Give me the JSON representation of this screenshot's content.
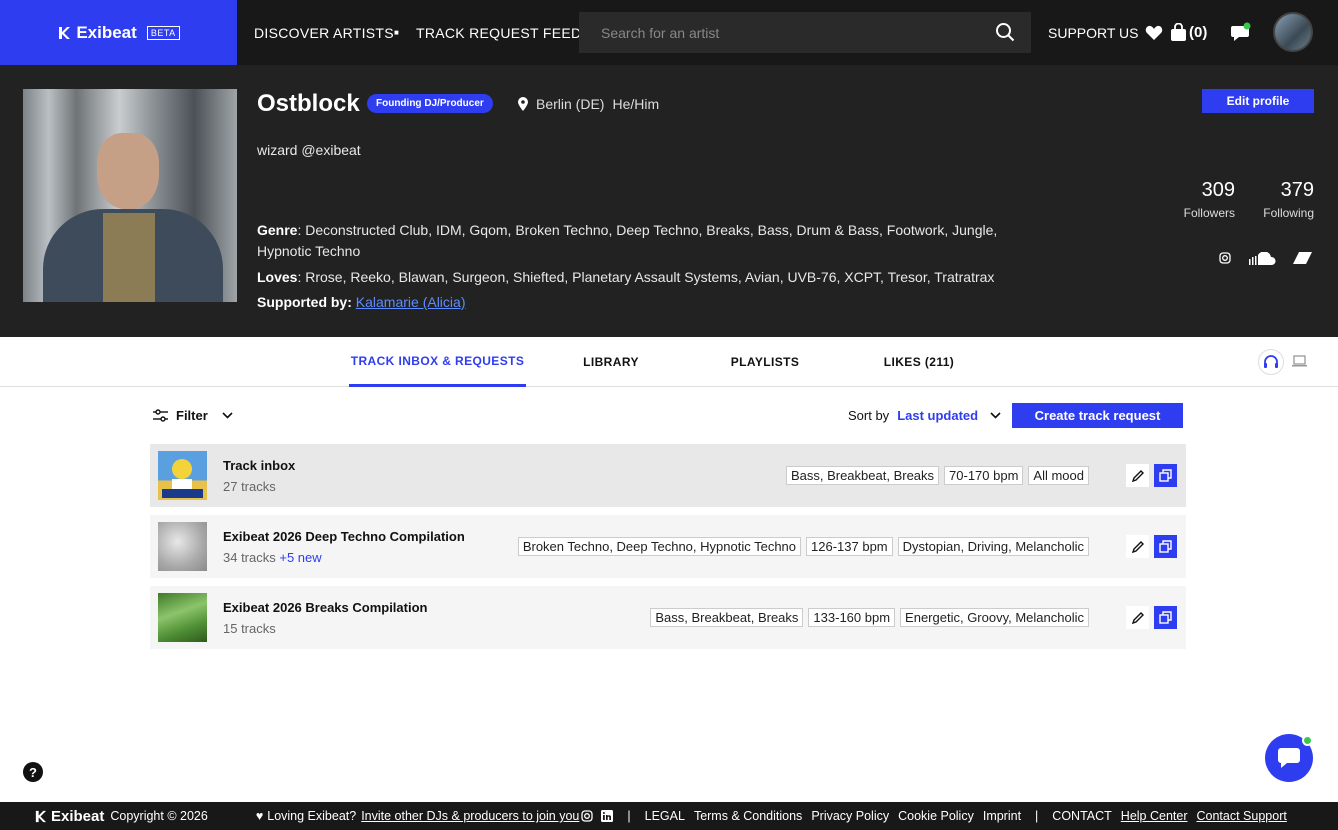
{
  "header": {
    "brand": "Exibeat",
    "beta": "BETA",
    "nav": [
      "DISCOVER ARTISTS",
      "TRACK REQUEST FEED"
    ],
    "search_placeholder": "Search for an artist",
    "support": "SUPPORT US",
    "cart_count": "(0)"
  },
  "profile": {
    "name": "Ostblock",
    "badge": "Founding DJ/Producer",
    "location": "Berlin (DE)",
    "pronouns": "He/Him",
    "bio": "wizard @exibeat",
    "genre_label": "Genre",
    "genres": ": Deconstructed Club, IDM, Gqom, Broken Techno, Deep Techno, Breaks, Bass, Drum & Bass, Footwork, Jungle, Hypnotic Techno",
    "loves_label": "Loves",
    "loves": ": Rrose, Reeko, Blawan, Surgeon, Shiefted, Planetary Assault Systems, Avian, UVB-76, XCPT, Tresor, Tratratrax",
    "supported_label": "Supported by:",
    "supported_by": "Kalamarie (Alicia)",
    "edit_button": "Edit profile",
    "followers_count": "309",
    "followers_label": "Followers",
    "following_count": "379",
    "following_label": "Following"
  },
  "tabs": [
    "TRACK INBOX & REQUESTS",
    "LIBRARY",
    "PLAYLISTS",
    "LIKES (211)"
  ],
  "toolbar": {
    "filter": "Filter",
    "sort_label": "Sort by",
    "sort_value": "Last updated",
    "create_button": "Create track request"
  },
  "rows": [
    {
      "title": "Track inbox",
      "sub": "27 tracks",
      "new": "",
      "tags": [
        "Bass, Breakbeat, Breaks",
        "70-170 bpm",
        "All mood"
      ],
      "thumb_color": "#4a8fd0"
    },
    {
      "title": "Exibeat 2026 Deep Techno Compilation",
      "sub": "34 tracks",
      "new": "+5 new",
      "tags": [
        "Broken Techno, Deep Techno, Hypnotic Techno",
        "126-137 bpm",
        "Dystopian, Driving, Melancholic"
      ],
      "thumb_color": "#bdbdbd"
    },
    {
      "title": "Exibeat 2026 Breaks Compilation",
      "sub": "15 tracks",
      "new": "",
      "tags": [
        "Bass, Breakbeat, Breaks",
        "133-160 bpm",
        "Energetic, Groovy, Melancholic"
      ],
      "thumb_color": "#5a9a3a"
    }
  ],
  "footer": {
    "brand": "Exibeat",
    "copyright": "Copyright © 2026",
    "loving": "Loving Exibeat?",
    "invite": "Invite other DJs & producers to join you",
    "legal": "LEGAL",
    "links": [
      "Terms & Conditions",
      "Privacy Policy",
      "Cookie Policy",
      "Imprint"
    ],
    "contact": "CONTACT",
    "help_center": "Help Center",
    "contact_support": "Contact Support"
  },
  "colors": {
    "accent": "#2f3df0",
    "dark": "#222222",
    "topbar": "#181818",
    "online": "#38c94a"
  }
}
